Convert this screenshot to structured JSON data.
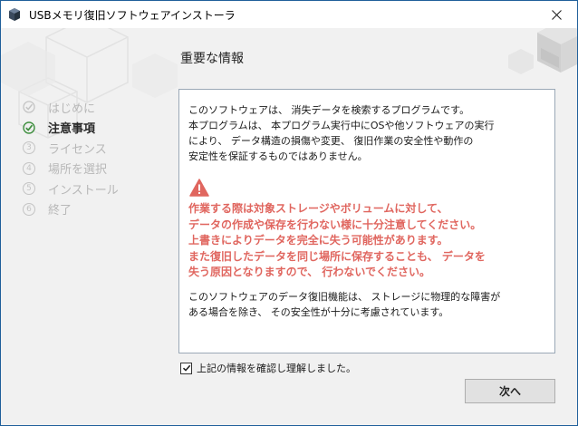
{
  "window": {
    "title": "USBメモリ復旧ソフトウェアインストーラ"
  },
  "steps": [
    {
      "label": "はじめに",
      "state": "done"
    },
    {
      "label": "注意事項",
      "state": "current"
    },
    {
      "label": "ライセンス",
      "state": "pending",
      "num": "3"
    },
    {
      "label": "場所を選択",
      "state": "pending",
      "num": "4"
    },
    {
      "label": "インストール",
      "state": "pending",
      "num": "5"
    },
    {
      "label": "終了",
      "state": "pending",
      "num": "6"
    }
  ],
  "main": {
    "title": "重要な情報",
    "intro": "このソフトウェアは、 消失データを検索するプログラムです。\n本プログラムは、 本プログラム実行中にOSや他ソフトウェアの実行\nにより、 データ構造の損傷や変更、 復旧作業の安全性や動作の\n安定性を保証するものではありません。",
    "warning": "作業する際は対象ストレージやボリュームに対して、\nデータの作成や保存を行わない様に十分注意してください。\n上書きによりデータを完全に失う可能性があります。\nまた復旧したデータを同じ場所に保存することも、 データを\n失う原因となりますので、 行わないでください。",
    "note": "このソフトウェアのデータ復旧機能は、 ストレージに物理的な障害が\nある場合を除き、 その安全性が十分に考慮されています。"
  },
  "confirm": {
    "label": "上記の情報を確認し理解しました。",
    "checked": true
  },
  "buttons": {
    "next": "次へ"
  },
  "colors": {
    "warning": "#e0665f",
    "accent": "#1f5f9a",
    "check": "#2e7d32"
  }
}
